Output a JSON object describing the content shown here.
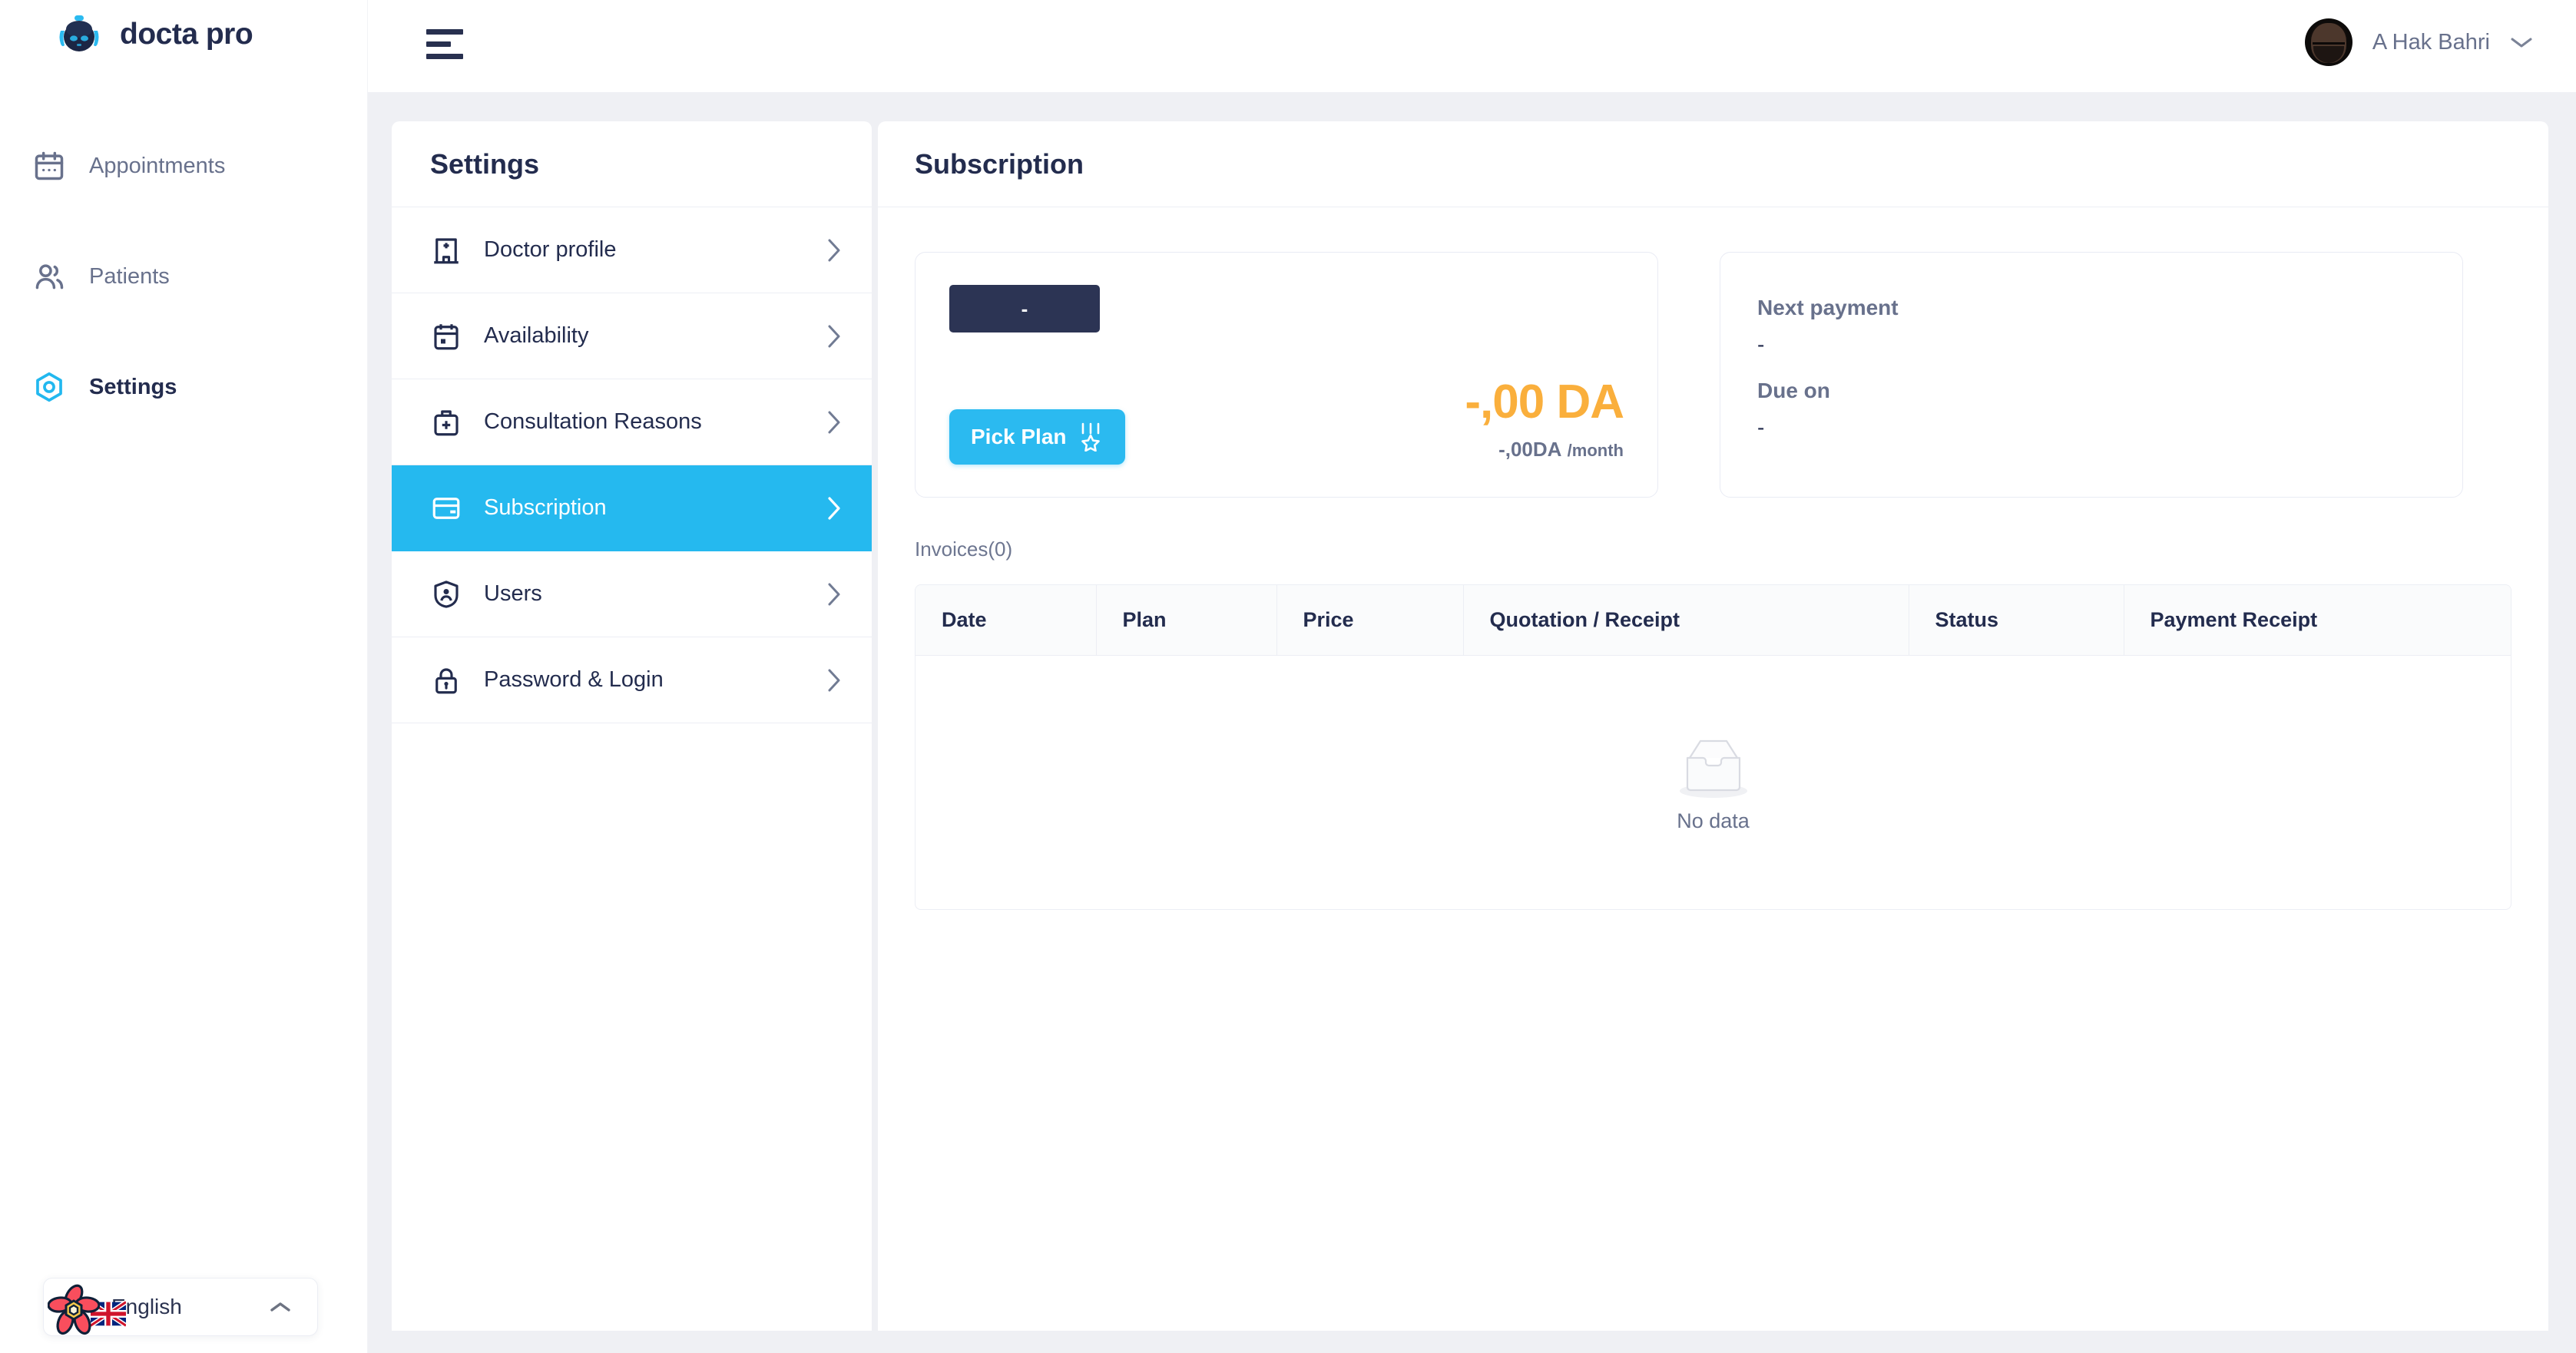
{
  "brand": {
    "name": "docta pro",
    "logo_icon": "robot-head-icon",
    "accent": "#25b9ef"
  },
  "topbar": {
    "menu_icon": "hamburger-menu-icon",
    "user": {
      "name": "A Hak Bahri",
      "avatar_icon": "user-avatar-photo",
      "caret_icon": "chevron-down-icon"
    }
  },
  "nav": {
    "items": [
      {
        "label": "Appointments",
        "icon": "calendar-icon",
        "active": false
      },
      {
        "label": "Patients",
        "icon": "users-icon",
        "active": false
      },
      {
        "label": "Settings",
        "icon": "hexagon-gear-icon",
        "active": true
      }
    ]
  },
  "language": {
    "label": "English",
    "flag_icon": "uk-flag-icon",
    "badge_icon": "flower-badge-icon",
    "caret_icon": "chevron-up-icon"
  },
  "settings": {
    "title": "Settings",
    "items": [
      {
        "label": "Doctor profile",
        "icon": "clinic-building-icon",
        "chevron": "chevron-right-icon",
        "active": false
      },
      {
        "label": "Availability",
        "icon": "calendar-check-icon",
        "chevron": "chevron-right-icon",
        "active": false
      },
      {
        "label": "Consultation Reasons",
        "icon": "medical-bag-plus-icon",
        "chevron": "chevron-right-icon",
        "active": false
      },
      {
        "label": "Subscription",
        "icon": "credit-card-icon",
        "chevron": "chevron-right-icon",
        "active": true
      },
      {
        "label": "Users",
        "icon": "shield-user-icon",
        "chevron": "chevron-right-icon",
        "active": false
      },
      {
        "label": "Password & Login",
        "icon": "padlock-icon",
        "chevron": "chevron-right-icon",
        "active": false
      }
    ]
  },
  "main": {
    "title": "Subscription",
    "plan_card": {
      "plan_badge": "-",
      "pick_plan_label": "Pick Plan",
      "pick_plan_icon": "medal-award-icon",
      "price_main": "-,00 DA",
      "price_amount": "-,00DA",
      "price_period": "/month",
      "price_color": "#faaf3c"
    },
    "next_payment_card": {
      "next_payment_label": "Next payment",
      "next_payment_value": "-",
      "due_on_label": "Due on",
      "due_on_value": "-"
    },
    "invoices": {
      "section_label": "Invoices(0)",
      "columns": [
        "Date",
        "Plan",
        "Price",
        "Quotation / Receipt",
        "Status",
        "Payment Receipt"
      ],
      "rows": [],
      "empty_text": "No data",
      "empty_icon": "empty-inbox-icon"
    }
  }
}
